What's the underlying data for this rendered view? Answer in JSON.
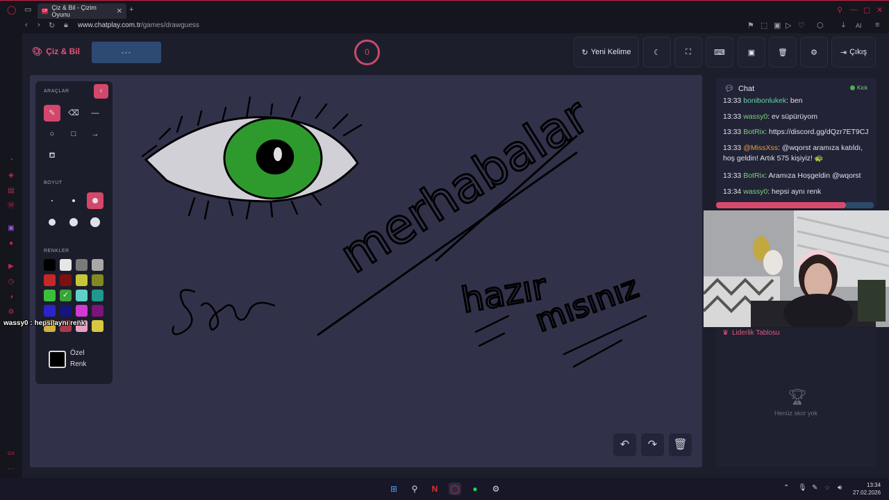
{
  "browser": {
    "tab_title": "Çiz & Bil - Çizim Oyunu",
    "tab_favicon_text": "CP",
    "url_domain": "www.chatplay.com.tr",
    "url_path": "/games/drawguess",
    "toolbar_ai": "AI"
  },
  "app": {
    "logo_text": "Çiz & Bil",
    "word_hint": "---",
    "timer": "0",
    "header_buttons": {
      "new_word": "Yeni Kelime",
      "exit": "Çıkış"
    }
  },
  "tools": {
    "section_tools": "ARAÇLAR",
    "section_size": "BOYUT",
    "section_colors": "RENKLER",
    "custom_color": "Özel Renk",
    "colors": [
      "#000000",
      "#e6e6e6",
      "#7a7a7a",
      "#a8a8a8",
      "#c62828",
      "#7d1010",
      "#c6c63a",
      "#808a20",
      "#3bbf3b",
      "#3aa23a",
      "#5fd2c8",
      "#20988c",
      "#2a25c8",
      "#15157a",
      "#d23ad2",
      "#7a157a",
      "#d2b040",
      "#a83a4a",
      "#e8a0c0",
      "#d8c840"
    ],
    "selected_color_index": 9
  },
  "chat": {
    "title": "Chat",
    "platform": "Kick",
    "messages": [
      {
        "time": "13:33",
        "user": "bonibonlukek",
        "text": ": ben"
      },
      {
        "time": "13:33",
        "user": "wassy0",
        "text": ": ev süpürüyom"
      },
      {
        "time": "13:33",
        "user": "BotRix",
        "text": ": https://discord.gg/dQzr7ET9CJ"
      },
      {
        "time": "13:33",
        "user": "@MissXss",
        "text": ": @wqorst aramıza katıldı, hoş geldin! Artık 575 kişiyiz! 🐢"
      },
      {
        "time": "13:33",
        "user": "BotRix",
        "text": ": Aramıza Hoşgeldin @wqorst"
      },
      {
        "time": "13:34",
        "user": "wassy0",
        "text": ": hepsi aynı renk"
      }
    ]
  },
  "overlay_message": "wassy0 : hepsi aynı renk",
  "leaderboard": {
    "title": "Liderlik Tablosu",
    "empty_text": "Henüz skor yok"
  },
  "drawing": {
    "words": [
      "merhabalar",
      "hazır",
      "mısınız"
    ]
  },
  "taskbar": {
    "time": "13:34",
    "date": "27.02.2026"
  },
  "colors": {
    "accent": "#d3476a",
    "background": "#1d1e2c",
    "canvas": "#31324a"
  }
}
